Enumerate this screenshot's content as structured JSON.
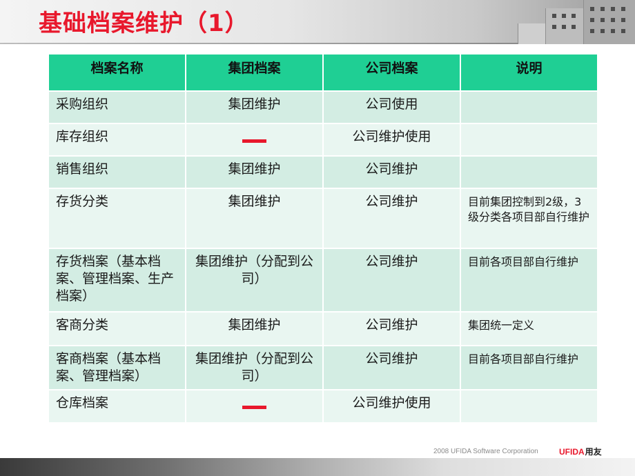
{
  "slide": {
    "title": "基础档案维护（1）"
  },
  "table": {
    "headers": [
      "档案名称",
      "集团档案",
      "公司档案",
      "说明"
    ],
    "rows": [
      [
        "采购组织",
        "集团维护",
        "公司使用",
        ""
      ],
      [
        "库存组织",
        "—",
        "公司维护使用",
        ""
      ],
      [
        "销售组织",
        "集团维护",
        "公司维护",
        ""
      ],
      [
        "存货分类",
        "集团维护",
        "公司维护",
        "目前集团控制到2级，3级分类各项目部自行维护"
      ],
      [
        "存货档案（基本档案、管理档案、生产档案）",
        "集团维护（分配到公司）",
        "公司维护",
        "目前各项目部自行维护"
      ],
      [
        "客商分类",
        "集团维护",
        "公司维护",
        "集团统一定义"
      ],
      [
        "客商档案（基本档案、管理档案）",
        "集团维护（分配到公司）",
        "公司维护",
        "目前各项目部自行维护"
      ],
      [
        "仓库档案",
        "—",
        "公司维护使用",
        ""
      ]
    ]
  },
  "footer": {
    "copyright": "2008 UFIDA Software Corporation",
    "brand": "UFIDA",
    "brand_cn": "用友"
  },
  "colors": {
    "title": "#e8182c",
    "header_fill": "#1fcf94",
    "row_dark": "#d3ede3",
    "row_light": "#e9f6f1"
  }
}
